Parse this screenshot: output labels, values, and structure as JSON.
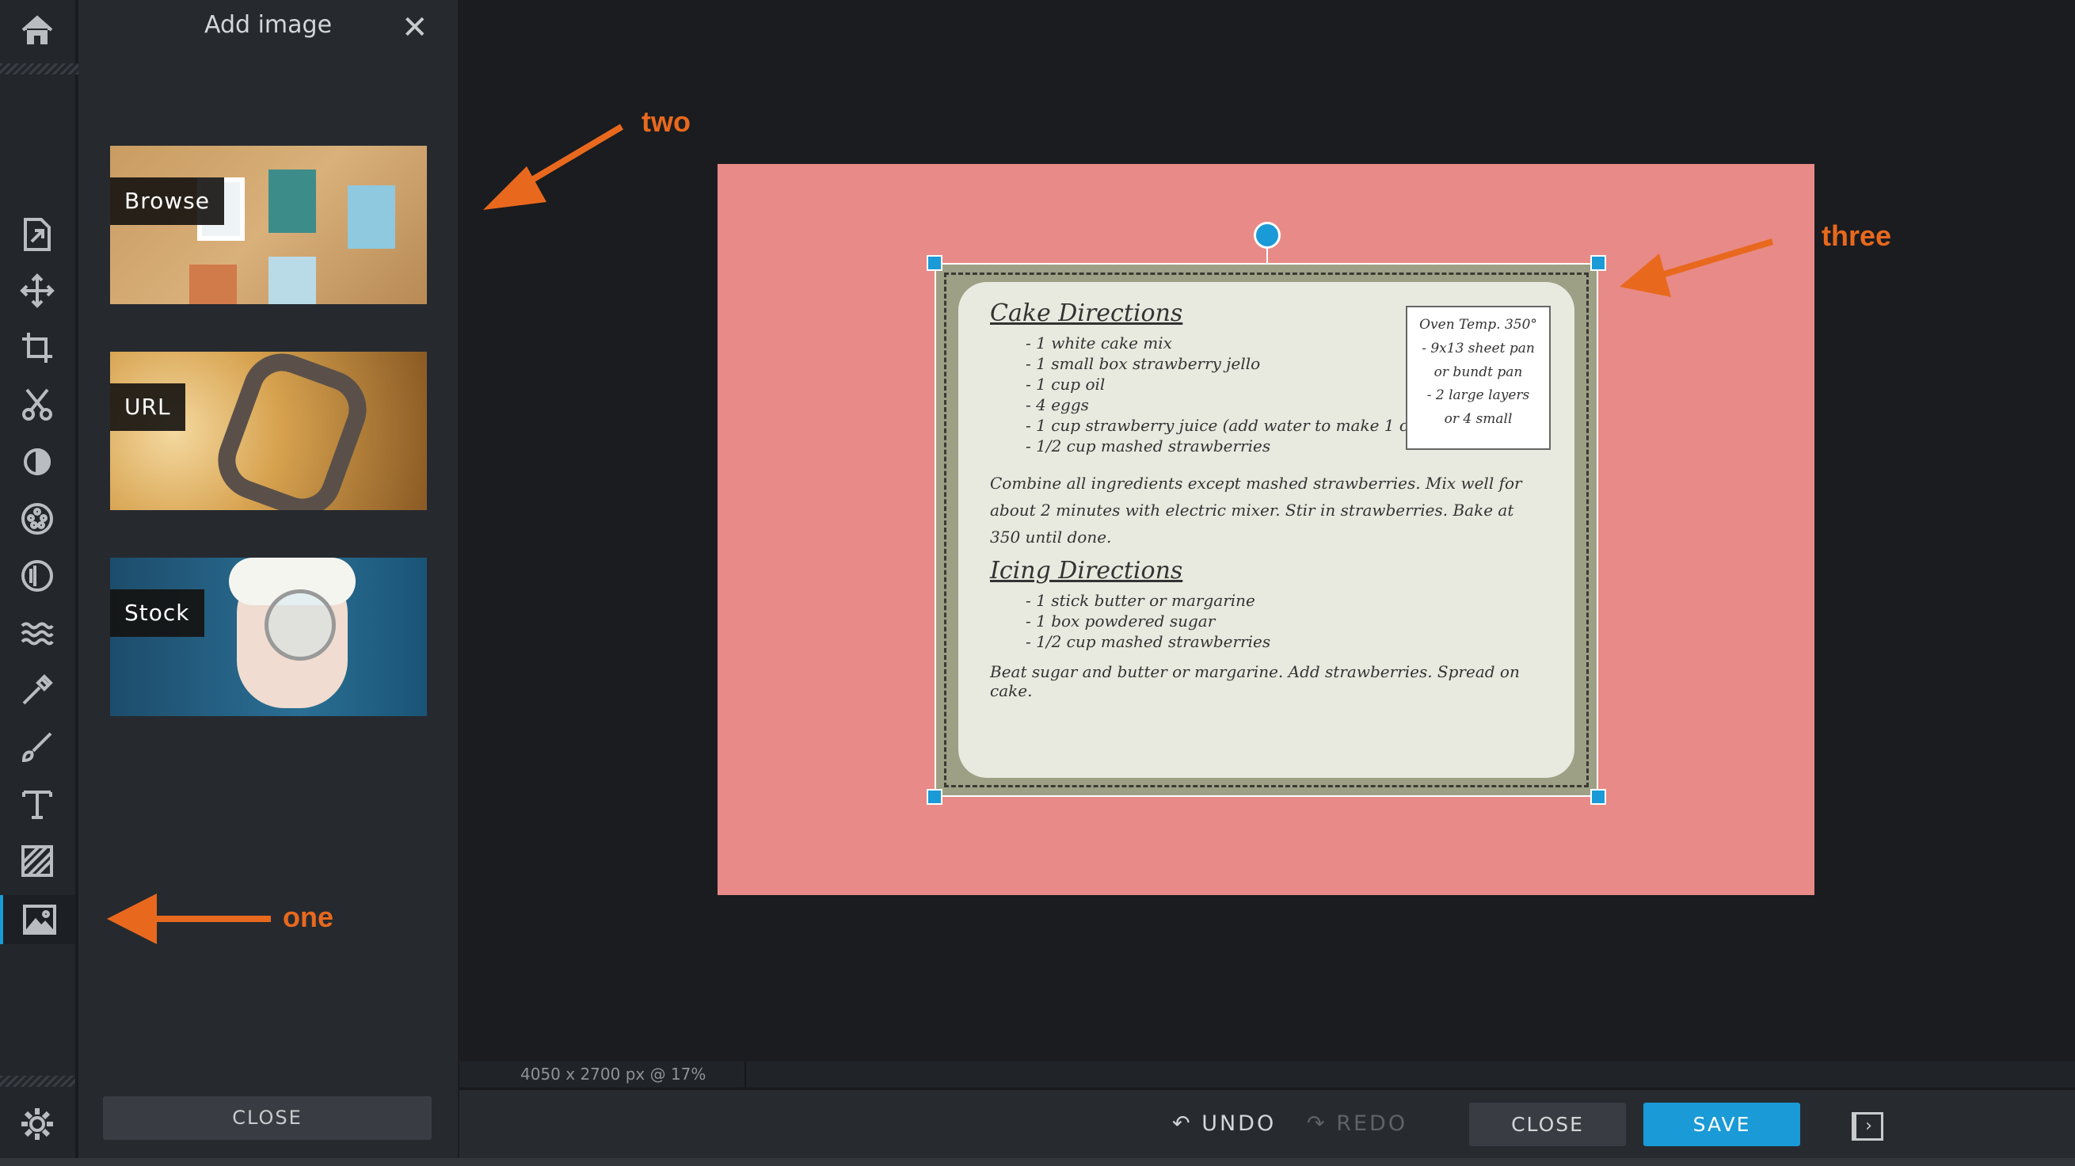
{
  "sidebar": {
    "icons": [
      "home-icon",
      "export-icon",
      "move-icon",
      "crop-icon",
      "cut-icon",
      "adjust-icon",
      "filter-icon",
      "vignette-icon",
      "waves-icon",
      "eyedropper-icon",
      "brush-icon",
      "text-icon",
      "texture-icon",
      "add-image-icon",
      "settings-icon"
    ],
    "active": "add-image-icon",
    "accent": "#1a9ad6"
  },
  "panel": {
    "title": "Add image",
    "tiles": [
      {
        "label": "Browse"
      },
      {
        "label": "URL"
      },
      {
        "label": "Stock"
      }
    ],
    "close_label": "CLOSE"
  },
  "annotations": {
    "one": "one",
    "two": "two",
    "three": "three",
    "color": "#e8691e"
  },
  "canvas": {
    "background": "#e88a87",
    "recipe": {
      "title1": "Cake Directions",
      "items1": [
        "- 1 white cake mix",
        "- 1 small box strawberry jello",
        "- 1 cup oil",
        "- 4 eggs",
        "- 1 cup strawberry juice (add water to make 1 cup)",
        "- 1/2 cup mashed strawberries"
      ],
      "note": [
        "Oven Temp. 350°",
        "- 9x13 sheet pan",
        "or bundt pan",
        "- 2 large layers",
        "or 4 small"
      ],
      "para1": "Combine all ingredients except mashed strawberries. Mix well for about 2 minutes with electric mixer. Stir in strawberries. Bake at 350 until done.",
      "title2": "Icing Directions",
      "items2": [
        "- 1 stick butter or margarine",
        "- 1 box powdered sugar",
        "- 1/2 cup mashed strawberries"
      ],
      "para2": "Beat sugar and butter or margarine. Add strawberries. Spread on cake."
    }
  },
  "status": {
    "text": "4050 x 2700 px @ 17%"
  },
  "toolbar": {
    "undo": "UNDO",
    "redo": "REDO",
    "close": "CLOSE",
    "save": "SAVE",
    "save_color": "#1a9ad6"
  }
}
